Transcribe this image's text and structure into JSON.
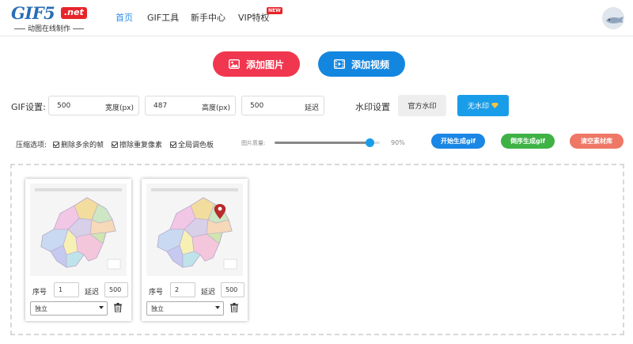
{
  "header": {
    "logo_main": "GIF5",
    "logo_net": ".net",
    "logo_sub": "动图在线制作",
    "nav": [
      {
        "label": "首页",
        "active": true
      },
      {
        "label": "GIF工具",
        "active": false
      },
      {
        "label": "新手中心",
        "active": false
      },
      {
        "label": "VIP特权",
        "active": false
      }
    ],
    "vip_badge": "NEW"
  },
  "actions": {
    "add_image": "添加图片",
    "add_video": "添加视频"
  },
  "gif_settings": {
    "label": "GIF设置:",
    "width": {
      "value": "500",
      "unit": "宽度(px)"
    },
    "height": {
      "value": "487",
      "unit": "高度(px)"
    },
    "delay": {
      "value": "500",
      "unit": "延迟"
    },
    "watermark_label": "水印设置",
    "official_watermark": "官方水印",
    "no_watermark": "无水印"
  },
  "compress": {
    "label": "压缩选项:",
    "options": [
      {
        "label": "删除多余的帧",
        "checked": true
      },
      {
        "label": "擦除重复像素",
        "checked": true
      },
      {
        "label": "全局调色板",
        "checked": true
      }
    ],
    "quality_label": "图片质量:",
    "quality_value": "90%",
    "quality_fraction": 0.9
  },
  "buttons": {
    "start": "开始生成gif",
    "reverse": "倒序生成gif",
    "clear": "清空素材库"
  },
  "frames": [
    {
      "index_label": "序号",
      "index": "1",
      "delay_label": "延迟",
      "delay": "500",
      "mode": "独立"
    },
    {
      "index_label": "序号",
      "index": "2",
      "delay_label": "延迟",
      "delay": "500",
      "mode": "独立"
    }
  ],
  "colors": {
    "brand_blue": "#2a6db5",
    "add_image_red": "#f0374f",
    "add_video_blue": "#1387e0",
    "start_blue": "#1a86e5",
    "reverse_green": "#3fb246",
    "clear_salmon": "#ee7765",
    "nav_active": "#2b8ee8"
  },
  "icons": [
    "image-icon",
    "video-icon",
    "diamond-icon",
    "trash-icon",
    "chevron-down-icon",
    "map-pin-icon"
  ]
}
